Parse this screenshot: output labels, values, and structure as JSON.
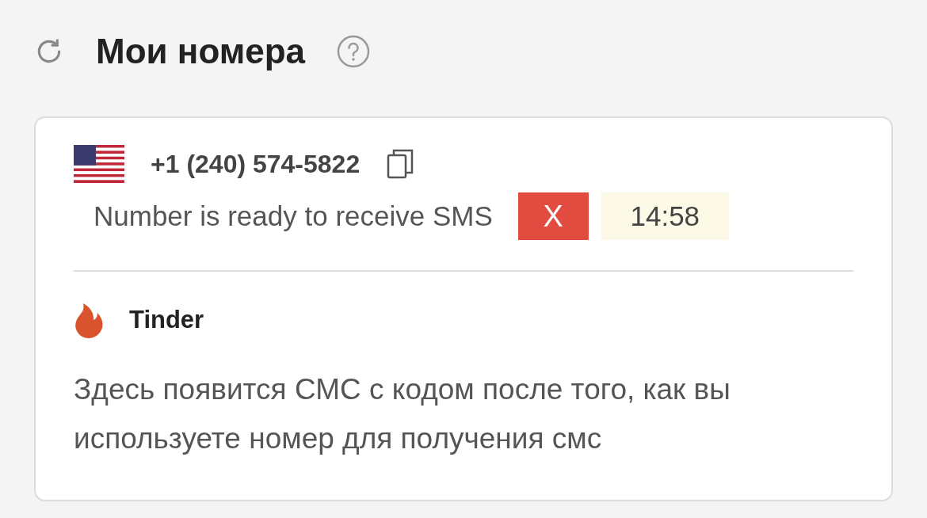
{
  "header": {
    "title": "Мои номера"
  },
  "number": {
    "phone": "+1 (240) 574-5822",
    "status": "Number is ready to receive SMS",
    "cancel_label": "X",
    "timer": "14:58"
  },
  "service": {
    "name": "Tinder",
    "message": "Здесь появится СМС с кодом после того, как вы используете номер для получения смс"
  }
}
